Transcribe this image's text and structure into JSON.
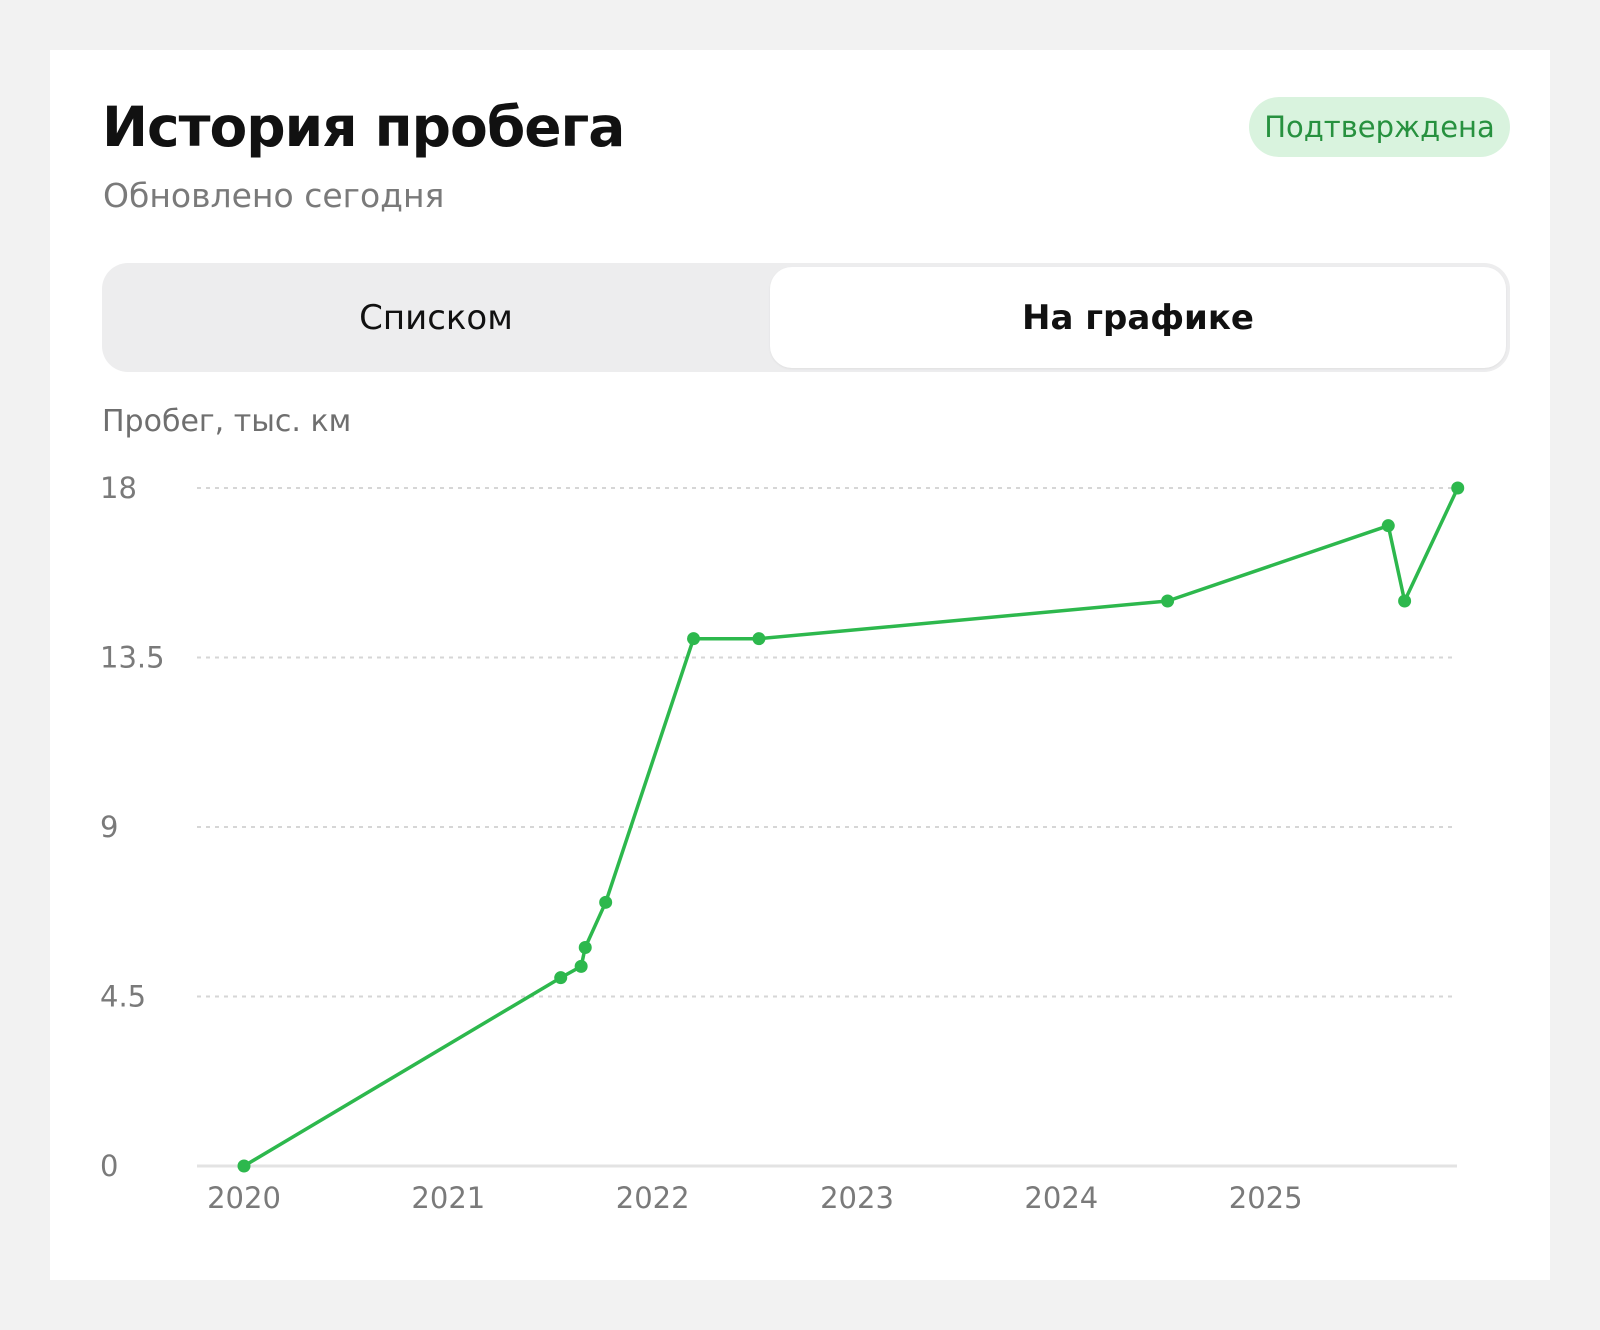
{
  "header": {
    "title": "История пробега",
    "subtitle": "Обновлено сегодня",
    "badge": "Подтверждена"
  },
  "view_switch": {
    "options": [
      "Списком",
      "На графике"
    ],
    "selected": "На графике"
  },
  "colors": {
    "accent": "#2db84d",
    "badge_bg": "#d9f3de",
    "badge_text": "#27913f"
  },
  "chart_data": {
    "type": "line",
    "ylabel": "Пробег, тыс. км",
    "xlabel": "",
    "y_ticks": [
      "0",
      "4.5",
      "9",
      "13.5",
      "18"
    ],
    "x_ticks": [
      "2020",
      "2021",
      "2022",
      "2023",
      "2024",
      "2025"
    ],
    "ylim": [
      0,
      18
    ],
    "xlim": [
      2020.0,
      2026.0
    ],
    "grid": true,
    "series": [
      {
        "points": [
          {
            "x": 2020.0,
            "y": 0.0
          },
          {
            "x": 2021.55,
            "y": 5.0
          },
          {
            "x": 2021.65,
            "y": 5.3
          },
          {
            "x": 2021.67,
            "y": 5.8
          },
          {
            "x": 2021.77,
            "y": 7.0
          },
          {
            "x": 2022.2,
            "y": 14.0
          },
          {
            "x": 2022.52,
            "y": 14.0
          },
          {
            "x": 2024.52,
            "y": 15.0
          },
          {
            "x": 2025.6,
            "y": 17.0
          },
          {
            "x": 2025.68,
            "y": 15.0
          },
          {
            "x": 2025.94,
            "y": 18.0
          }
        ]
      }
    ]
  }
}
